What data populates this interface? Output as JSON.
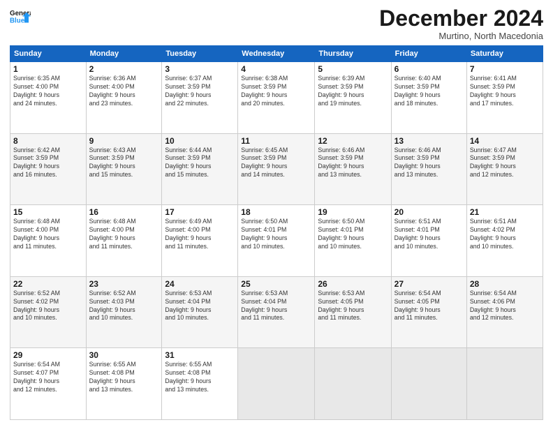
{
  "header": {
    "logo_line1": "General",
    "logo_line2": "Blue",
    "month": "December 2024",
    "location": "Murtino, North Macedonia"
  },
  "weekdays": [
    "Sunday",
    "Monday",
    "Tuesday",
    "Wednesday",
    "Thursday",
    "Friday",
    "Saturday"
  ],
  "weeks": [
    [
      {
        "day": "1",
        "info": "Sunrise: 6:35 AM\nSunset: 4:00 PM\nDaylight: 9 hours\nand 24 minutes."
      },
      {
        "day": "2",
        "info": "Sunrise: 6:36 AM\nSunset: 4:00 PM\nDaylight: 9 hours\nand 23 minutes."
      },
      {
        "day": "3",
        "info": "Sunrise: 6:37 AM\nSunset: 3:59 PM\nDaylight: 9 hours\nand 22 minutes."
      },
      {
        "day": "4",
        "info": "Sunrise: 6:38 AM\nSunset: 3:59 PM\nDaylight: 9 hours\nand 20 minutes."
      },
      {
        "day": "5",
        "info": "Sunrise: 6:39 AM\nSunset: 3:59 PM\nDaylight: 9 hours\nand 19 minutes."
      },
      {
        "day": "6",
        "info": "Sunrise: 6:40 AM\nSunset: 3:59 PM\nDaylight: 9 hours\nand 18 minutes."
      },
      {
        "day": "7",
        "info": "Sunrise: 6:41 AM\nSunset: 3:59 PM\nDaylight: 9 hours\nand 17 minutes."
      }
    ],
    [
      {
        "day": "8",
        "info": "Sunrise: 6:42 AM\nSunset: 3:59 PM\nDaylight: 9 hours\nand 16 minutes."
      },
      {
        "day": "9",
        "info": "Sunrise: 6:43 AM\nSunset: 3:59 PM\nDaylight: 9 hours\nand 15 minutes."
      },
      {
        "day": "10",
        "info": "Sunrise: 6:44 AM\nSunset: 3:59 PM\nDaylight: 9 hours\nand 15 minutes."
      },
      {
        "day": "11",
        "info": "Sunrise: 6:45 AM\nSunset: 3:59 PM\nDaylight: 9 hours\nand 14 minutes."
      },
      {
        "day": "12",
        "info": "Sunrise: 6:46 AM\nSunset: 3:59 PM\nDaylight: 9 hours\nand 13 minutes."
      },
      {
        "day": "13",
        "info": "Sunrise: 6:46 AM\nSunset: 3:59 PM\nDaylight: 9 hours\nand 13 minutes."
      },
      {
        "day": "14",
        "info": "Sunrise: 6:47 AM\nSunset: 3:59 PM\nDaylight: 9 hours\nand 12 minutes."
      }
    ],
    [
      {
        "day": "15",
        "info": "Sunrise: 6:48 AM\nSunset: 4:00 PM\nDaylight: 9 hours\nand 11 minutes."
      },
      {
        "day": "16",
        "info": "Sunrise: 6:48 AM\nSunset: 4:00 PM\nDaylight: 9 hours\nand 11 minutes."
      },
      {
        "day": "17",
        "info": "Sunrise: 6:49 AM\nSunset: 4:00 PM\nDaylight: 9 hours\nand 11 minutes."
      },
      {
        "day": "18",
        "info": "Sunrise: 6:50 AM\nSunset: 4:01 PM\nDaylight: 9 hours\nand 10 minutes."
      },
      {
        "day": "19",
        "info": "Sunrise: 6:50 AM\nSunset: 4:01 PM\nDaylight: 9 hours\nand 10 minutes."
      },
      {
        "day": "20",
        "info": "Sunrise: 6:51 AM\nSunset: 4:01 PM\nDaylight: 9 hours\nand 10 minutes."
      },
      {
        "day": "21",
        "info": "Sunrise: 6:51 AM\nSunset: 4:02 PM\nDaylight: 9 hours\nand 10 minutes."
      }
    ],
    [
      {
        "day": "22",
        "info": "Sunrise: 6:52 AM\nSunset: 4:02 PM\nDaylight: 9 hours\nand 10 minutes."
      },
      {
        "day": "23",
        "info": "Sunrise: 6:52 AM\nSunset: 4:03 PM\nDaylight: 9 hours\nand 10 minutes."
      },
      {
        "day": "24",
        "info": "Sunrise: 6:53 AM\nSunset: 4:04 PM\nDaylight: 9 hours\nand 10 minutes."
      },
      {
        "day": "25",
        "info": "Sunrise: 6:53 AM\nSunset: 4:04 PM\nDaylight: 9 hours\nand 11 minutes."
      },
      {
        "day": "26",
        "info": "Sunrise: 6:53 AM\nSunset: 4:05 PM\nDaylight: 9 hours\nand 11 minutes."
      },
      {
        "day": "27",
        "info": "Sunrise: 6:54 AM\nSunset: 4:05 PM\nDaylight: 9 hours\nand 11 minutes."
      },
      {
        "day": "28",
        "info": "Sunrise: 6:54 AM\nSunset: 4:06 PM\nDaylight: 9 hours\nand 12 minutes."
      }
    ],
    [
      {
        "day": "29",
        "info": "Sunrise: 6:54 AM\nSunset: 4:07 PM\nDaylight: 9 hours\nand 12 minutes."
      },
      {
        "day": "30",
        "info": "Sunrise: 6:55 AM\nSunset: 4:08 PM\nDaylight: 9 hours\nand 13 minutes."
      },
      {
        "day": "31",
        "info": "Sunrise: 6:55 AM\nSunset: 4:08 PM\nDaylight: 9 hours\nand 13 minutes."
      },
      {
        "day": "",
        "info": ""
      },
      {
        "day": "",
        "info": ""
      },
      {
        "day": "",
        "info": ""
      },
      {
        "day": "",
        "info": ""
      }
    ]
  ]
}
